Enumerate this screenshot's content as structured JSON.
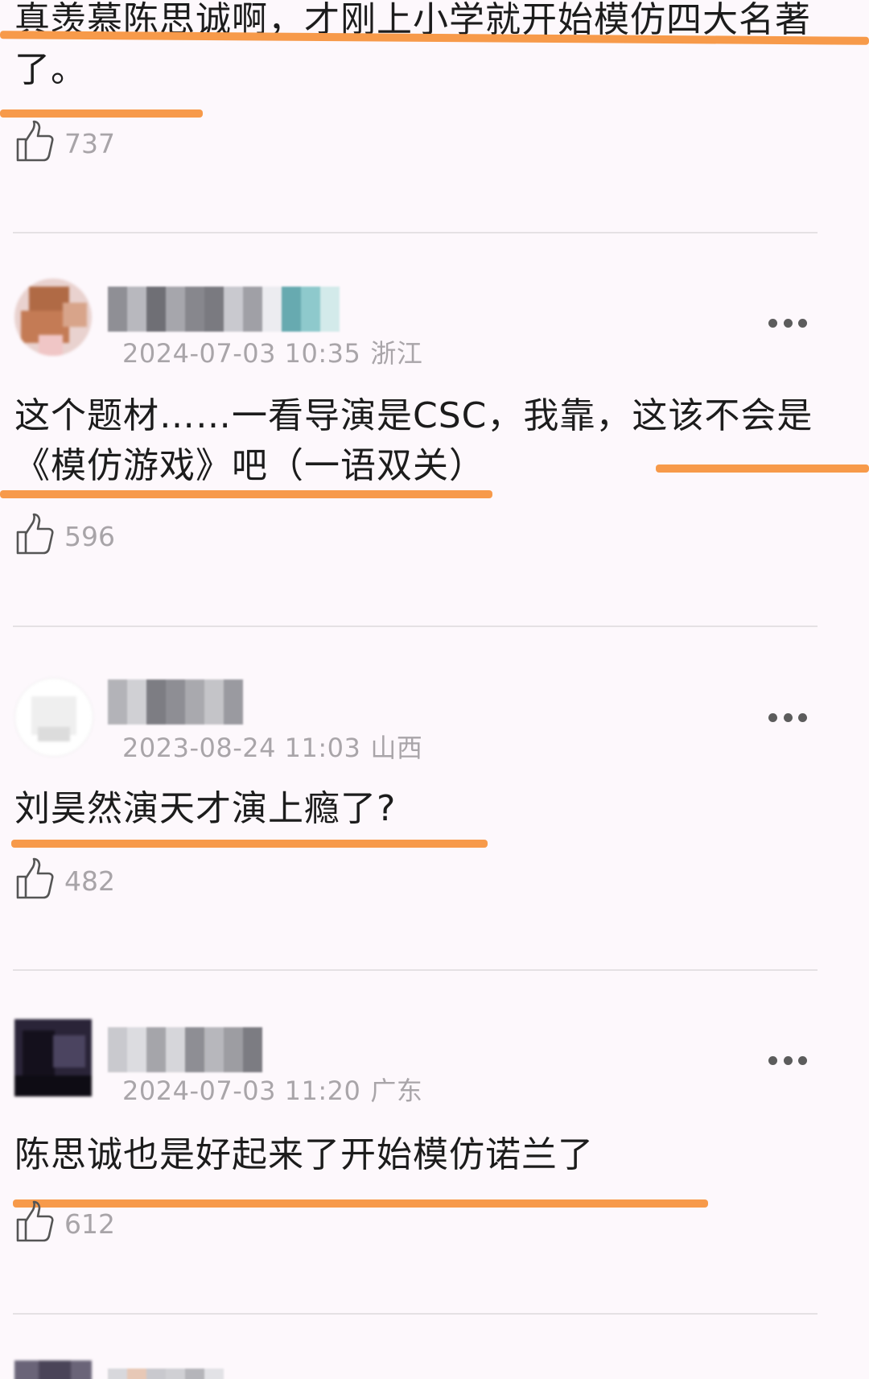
{
  "colors": {
    "highlight_stroke": "#f79a4a",
    "background": "#fdf8fc",
    "meta_text": "#a9a5a9",
    "body_text": "#1c1c1c"
  },
  "comments": [
    {
      "text": "真羡慕陈思诚啊，才刚上小学就开始模仿四大名著了。",
      "likes": "737",
      "like_icon": "thumbs-up-icon"
    },
    {
      "date": "2024-07-03 10:35",
      "location": "浙江",
      "text": "这个题材……一看导演是CSC，我靠，这该不会是《模仿游戏》吧（一语双关）",
      "likes": "596",
      "more_icon": "more-dots-icon"
    },
    {
      "date": "2023-08-24 11:03",
      "location": "山西",
      "text": "刘昊然演天才演上瘾了?",
      "likes": "482",
      "more_icon": "more-dots-icon"
    },
    {
      "date": "2024-07-03 11:20",
      "location": "广东",
      "text": "陈思诚也是好起来了开始模仿诺兰了",
      "likes": "612",
      "more_icon": "more-dots-icon"
    }
  ]
}
